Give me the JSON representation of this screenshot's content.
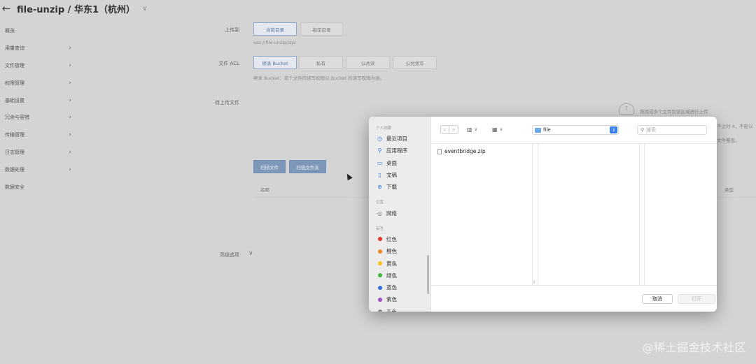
{
  "header": {
    "back_icon": "arrow-left-icon",
    "title": "file-unzip / 华东1（杭州）"
  },
  "sidebar": {
    "items": [
      {
        "label": "概览",
        "chevron": false
      },
      {
        "label": "用量查询",
        "chevron": true
      },
      {
        "label": "文件管理",
        "chevron": true
      },
      {
        "label": "权限管理",
        "chevron": true
      },
      {
        "label": "基础设置",
        "chevron": true
      },
      {
        "label": "冗余与容错",
        "chevron": true
      },
      {
        "label": "传输管理",
        "chevron": true
      },
      {
        "label": "日志管理",
        "chevron": true
      },
      {
        "label": "数据处理",
        "chevron": true
      },
      {
        "label": "数据安全",
        "chevron": false
      }
    ]
  },
  "form": {
    "upload_to_label": "上传到",
    "upload_to_options": [
      "当前目录",
      "指定目录"
    ],
    "upload_path": "oss://file-unzip/zip/",
    "acl_label": "文件 ACL",
    "acl_options": [
      "继承 Bucket",
      "私有",
      "公共读",
      "公共读写"
    ],
    "acl_hint": "继承 Bucket：单个文件的读写权限以 Bucket 的读写权限为准。",
    "files_label": "待上传文件",
    "drop_hint": "拖拽或多个文件到该区域进行上传",
    "right_hint_1": "不之时 4，不能以",
    "right_hint_2": "文件覆盖。",
    "scan_files": "扫描文件",
    "scan_folder": "扫描文件夹",
    "col_name": "名称",
    "col_type": "类型",
    "advanced_label": "高级选项"
  },
  "dialog": {
    "favorites_title": "个人收藏",
    "favorites": [
      {
        "label": "最近项目",
        "icon": "clock-icon"
      },
      {
        "label": "应用程序",
        "icon": "apps-icon"
      },
      {
        "label": "桌面",
        "icon": "desktop-icon"
      },
      {
        "label": "文稿",
        "icon": "document-icon"
      },
      {
        "label": "下载",
        "icon": "download-icon"
      }
    ],
    "locations_title": "位置",
    "locations": [
      {
        "label": "网络",
        "icon": "network-icon"
      }
    ],
    "tags_title": "标签",
    "tags": [
      {
        "label": "红色",
        "color": "#e0352b"
      },
      {
        "label": "橙色",
        "color": "#ee8a24"
      },
      {
        "label": "黄色",
        "color": "#f2c21a"
      },
      {
        "label": "绿色",
        "color": "#3bb53a"
      },
      {
        "label": "蓝色",
        "color": "#2f6fd8"
      },
      {
        "label": "紫色",
        "color": "#9a4fc6"
      },
      {
        "label": "灰色",
        "color": "#8a8a8a"
      }
    ],
    "folder": "file",
    "search_placeholder": "搜索",
    "files": [
      "eventbridge.zip"
    ],
    "cancel_label": "取消",
    "open_label": "打开"
  },
  "watermark": "@稀土掘金技术社区"
}
